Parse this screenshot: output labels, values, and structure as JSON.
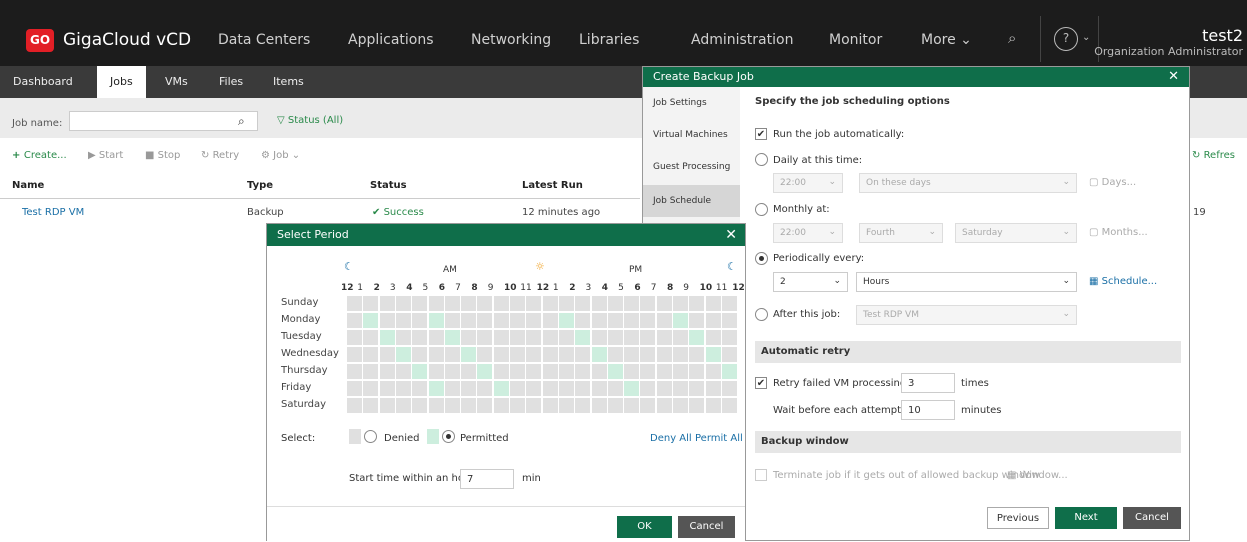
{
  "nav": {
    "logo": "GO",
    "brand": "GigaCloud vCD",
    "items": [
      "Data Centers",
      "Applications",
      "Networking",
      "Libraries",
      "Administration",
      "Monitor",
      "More"
    ],
    "user": "test2",
    "role": "Organization Administrator"
  },
  "tabs": [
    "Dashboard",
    "Jobs",
    "VMs",
    "Files",
    "Items"
  ],
  "filter": {
    "job_name_label": "Job name:",
    "status": "Status (All)"
  },
  "toolbar": {
    "create": "Create...",
    "start": "Start",
    "stop": "Stop",
    "retry": "Retry",
    "job": "Job",
    "refresh": "Refres"
  },
  "table": {
    "headers": [
      "Name",
      "Type",
      "Status",
      "Latest Run"
    ],
    "row": {
      "name": "Test RDP VM",
      "type": "Backup",
      "status": "Success",
      "latest": "12 minutes ago",
      "extra": "19"
    }
  },
  "period": {
    "title": "Select Period",
    "am": "AM",
    "pm": "PM",
    "hours": [
      "12",
      "1",
      "2",
      "3",
      "4",
      "5",
      "6",
      "7",
      "8",
      "9",
      "10",
      "11",
      "12",
      "1",
      "2",
      "3",
      "4",
      "5",
      "6",
      "7",
      "8",
      "9",
      "10",
      "11",
      "12"
    ],
    "days": [
      "Sunday",
      "Monday",
      "Tuesday",
      "Wednesday",
      "Thursday",
      "Friday",
      "Saturday"
    ],
    "permitted": [
      [],
      [
        1,
        5,
        13,
        20
      ],
      [
        2,
        6,
        14,
        21
      ],
      [
        3,
        7,
        15,
        22
      ],
      [
        4,
        8,
        16,
        23
      ],
      [
        5,
        9,
        17
      ],
      []
    ],
    "select": "Select:",
    "denied": "Denied",
    "permitted_lbl": "Permitted",
    "deny_all": "Deny All",
    "permit_all": "Permit All",
    "start_label": "Start time within an hour:",
    "start_value": "7",
    "min": "min",
    "ok": "OK",
    "cancel": "Cancel"
  },
  "backup": {
    "title": "Create Backup Job",
    "steps": [
      "Job Settings",
      "Virtual Machines",
      "Guest Processing",
      "Job Schedule"
    ],
    "heading": "Specify the job scheduling options",
    "run_auto": "Run the job automatically:",
    "daily": "Daily at this time:",
    "daily_time": "22:00",
    "daily_days": "On these days",
    "days_btn": "Days...",
    "monthly": "Monthly at:",
    "monthly_time": "22:00",
    "fourth": "Fourth",
    "saturday": "Saturday",
    "months_btn": "Months...",
    "periodic": "Periodically every:",
    "period_val": "2",
    "period_unit": "Hours",
    "schedule_btn": "Schedule...",
    "after": "After this job:",
    "after_job": "Test RDP VM",
    "retry_head": "Automatic retry",
    "retry": "Retry failed VM processing:",
    "retry_val": "3",
    "times": "times",
    "wait": "Wait before each attempt for:",
    "wait_val": "10",
    "minutes": "minutes",
    "window_head": "Backup window",
    "terminate": "Terminate job if it gets out of allowed backup window",
    "window_btn": "Window...",
    "previous": "Previous",
    "next": "Next",
    "cancel": "Cancel"
  }
}
